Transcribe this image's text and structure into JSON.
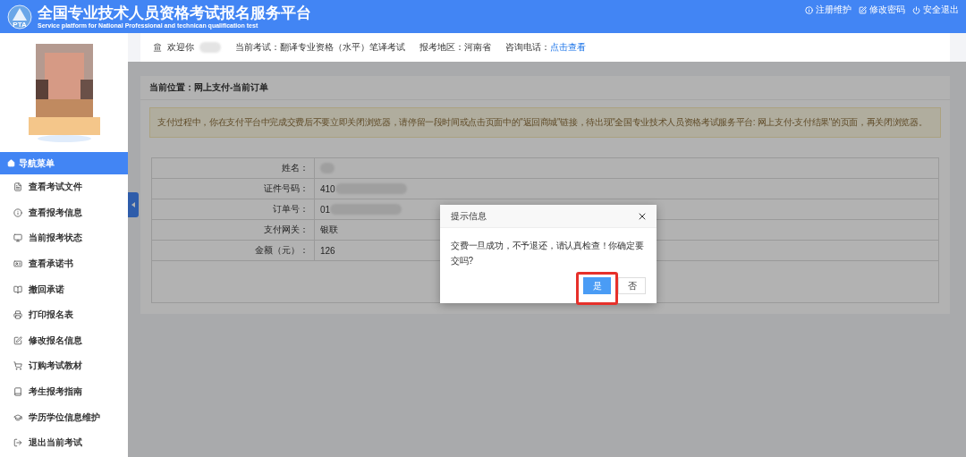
{
  "header": {
    "logo_text": "PTA",
    "title": "全国专业技术人员资格考试报名服务平台",
    "subtitle": "Service platform for National Professional and technican qualification test",
    "links": [
      "注册维护",
      "修改密码",
      "安全退出"
    ]
  },
  "sidebar": {
    "menu_title": "导航菜单",
    "items": [
      {
        "label": "查看考试文件"
      },
      {
        "label": "查看报考信息"
      },
      {
        "label": "当前报考状态"
      },
      {
        "label": "查看承诺书"
      },
      {
        "label": "撤回承诺"
      },
      {
        "label": "打印报名表"
      },
      {
        "label": "修改报名信息"
      },
      {
        "label": "订购考试教材"
      },
      {
        "label": "考生报考指南"
      },
      {
        "label": "学历学位信息维护"
      },
      {
        "label": "退出当前考试"
      }
    ]
  },
  "info_bar": {
    "welcome": "欢迎你",
    "fields": [
      {
        "label": "当前考试：",
        "value": "翻译专业资格（水平）笔译考试",
        "kind": "text"
      },
      {
        "label": "报考地区：",
        "value": "河南省",
        "kind": "text"
      },
      {
        "label": "咨询电话：",
        "value": "点击查看",
        "kind": "link"
      }
    ]
  },
  "breadcrumb": "当前位置：网上支付-当前订单",
  "notice": "支付过程中，你在支付平台中完成交费后不要立即关闭浏览器，请停留一段时间或点击页面中的\"返回商城\"链接，待出现\"全国专业技术人员资格考试服务平台: 网上支付-支付结果\"的页面，再关闭浏览器。",
  "order_table": {
    "rows": [
      {
        "label": "姓名：",
        "value": "",
        "redacted": true
      },
      {
        "label": "证件号码：",
        "value": "410",
        "redacted": true
      },
      {
        "label": "订单号：",
        "value": "01",
        "redacted": true
      },
      {
        "label": "支付网关：",
        "value": "银联",
        "redacted": false
      },
      {
        "label": "金额（元）：",
        "value": "126",
        "redacted": false
      }
    ]
  },
  "dialog": {
    "title": "提示信息",
    "message": "交费一旦成功，不予退还，请认真检查！你确定要交吗?",
    "buttons": [
      {
        "label": "是",
        "kind": "primary",
        "highlighted": true
      },
      {
        "label": "否",
        "kind": "default",
        "highlighted": false
      }
    ]
  }
}
